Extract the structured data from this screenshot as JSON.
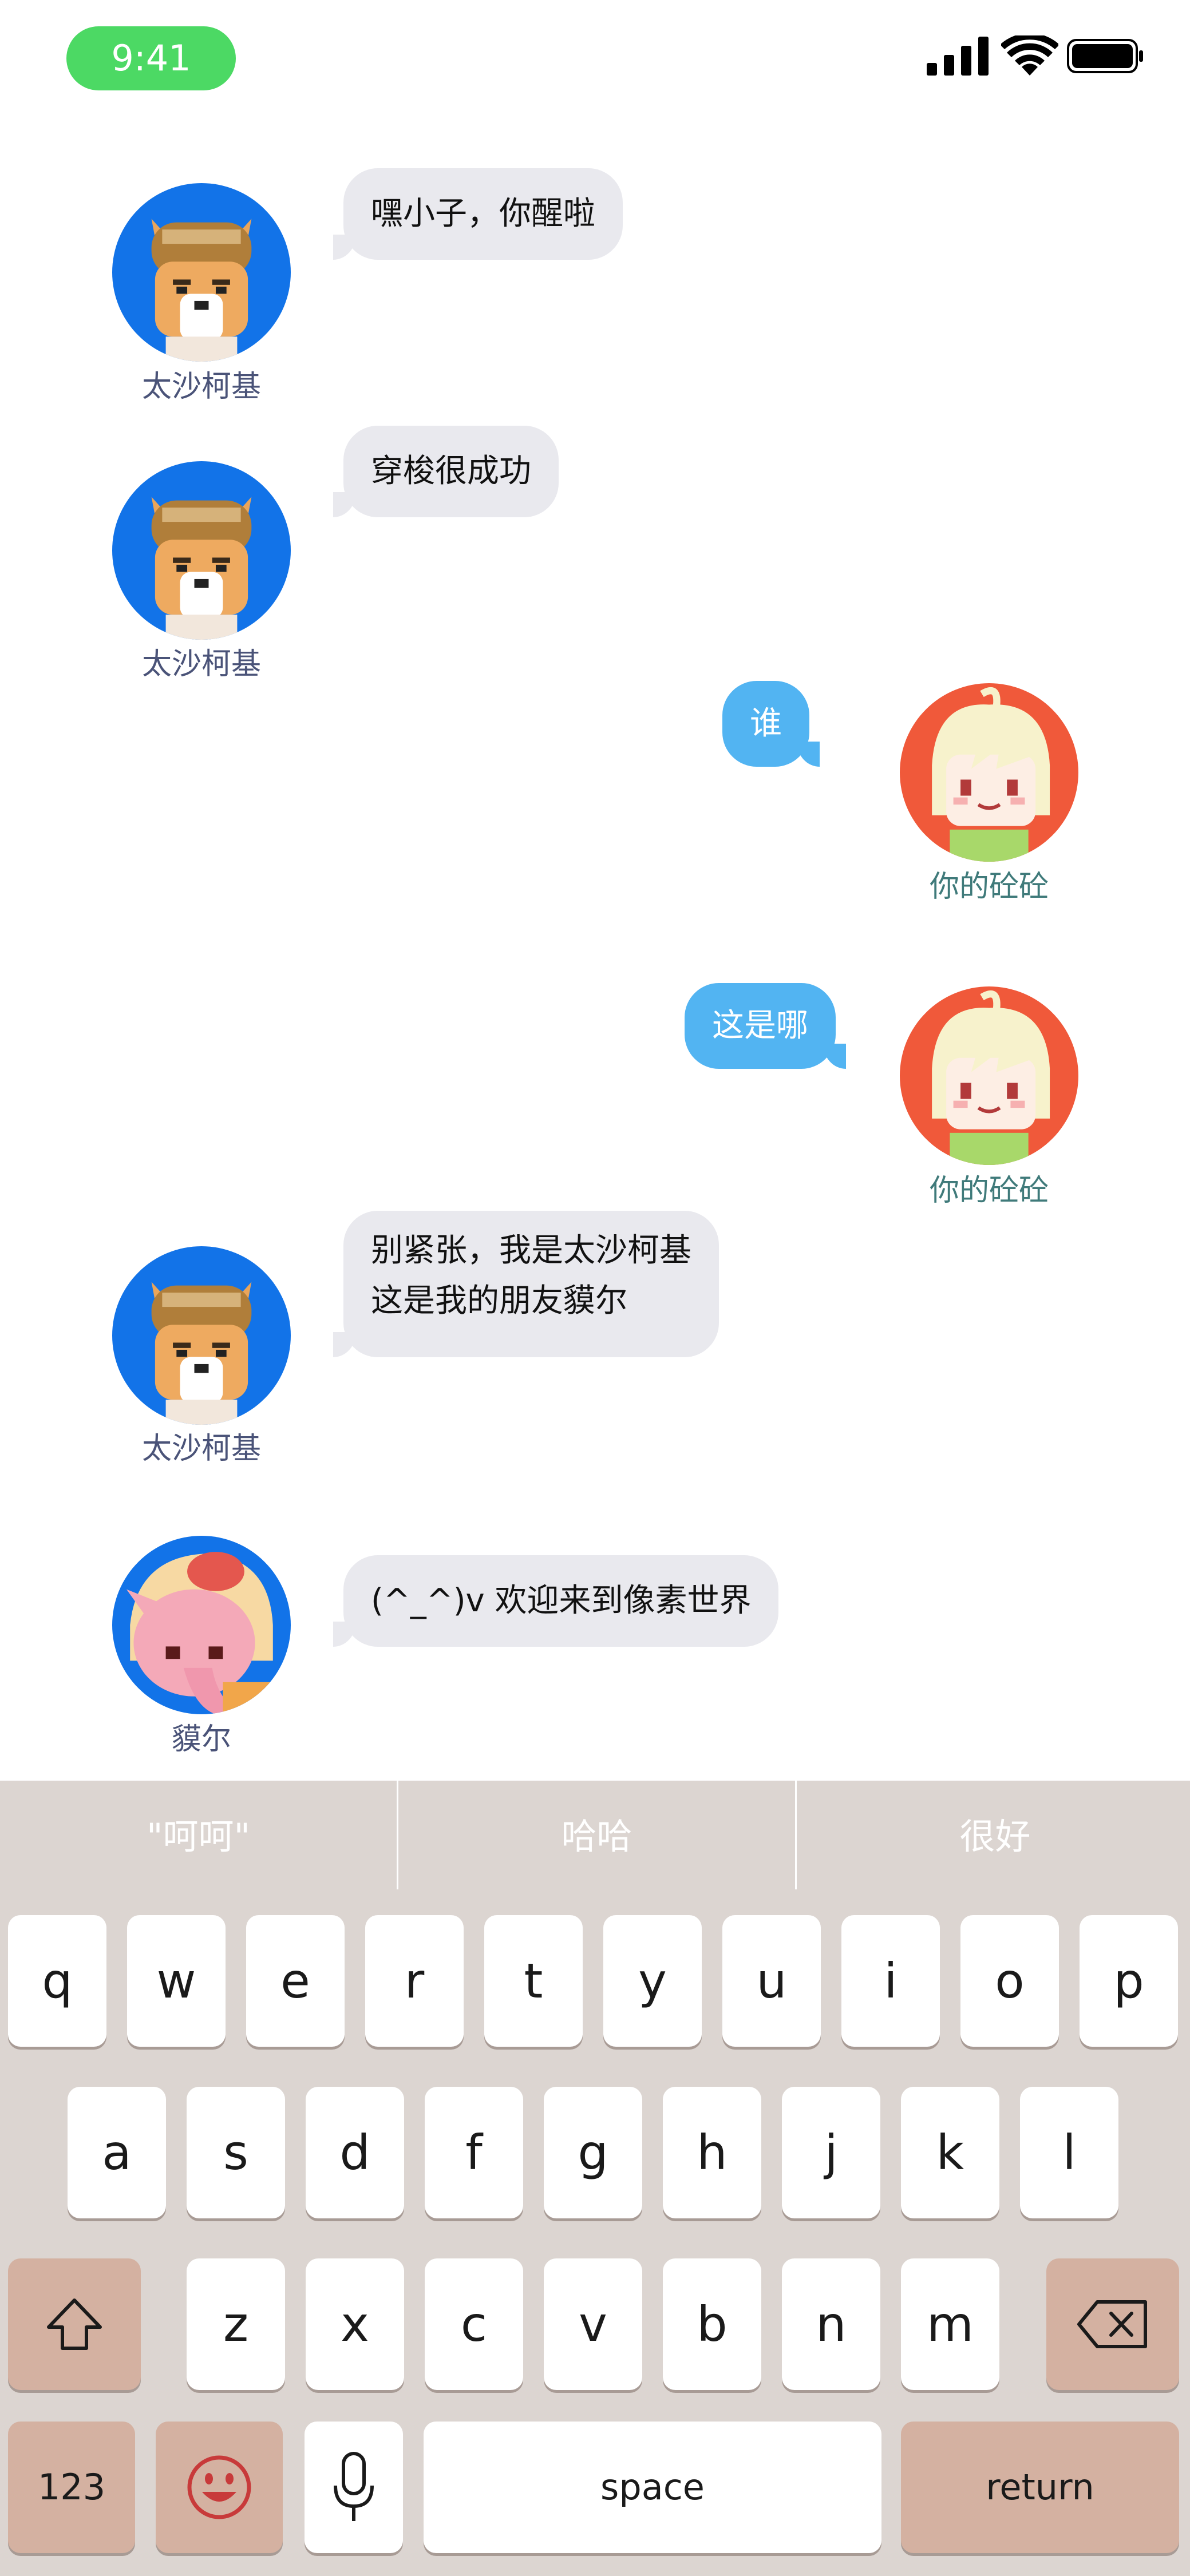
{
  "status_bar": {
    "time": "9:41"
  },
  "messages": [
    {
      "side": "left",
      "sender": "太沙柯基",
      "lines": [
        "嘿小子，你醒啦"
      ]
    },
    {
      "side": "left",
      "sender": "太沙柯基",
      "lines": [
        "穿梭很成功"
      ]
    },
    {
      "side": "right",
      "sender": "你的砼砼",
      "lines": [
        "谁"
      ]
    },
    {
      "side": "right",
      "sender": "你的砼砼",
      "lines": [
        "这是哪"
      ]
    },
    {
      "side": "left",
      "sender": "太沙柯基",
      "lines": [
        "别紧张，我是太沙柯基",
        "这是我的朋友貘尔"
      ]
    },
    {
      "side": "left",
      "sender": "貘尔",
      "lines": [
        "(^_^)v 欢迎来到像素世界"
      ]
    }
  ],
  "keyboard": {
    "suggestions": [
      "\"呵呵\"",
      "哈哈",
      "很好"
    ],
    "row1": [
      "q",
      "w",
      "e",
      "r",
      "t",
      "y",
      "u",
      "i",
      "o",
      "p"
    ],
    "row2": [
      "a",
      "s",
      "d",
      "f",
      "g",
      "h",
      "j",
      "k",
      "l"
    ],
    "row3": [
      "z",
      "x",
      "c",
      "v",
      "b",
      "n",
      "m"
    ],
    "numbers_label": "123",
    "space_label": "space",
    "return_label": "return"
  },
  "colors": {
    "outgoing_bubble": "#52b4f2",
    "incoming_bubble": "#e9e9ee",
    "corgi_avatar_bg": "#1273e8",
    "tongtong_avatar_bg": "#f0593a",
    "moer_avatar_bg": "#1273e8",
    "time_pill": "#4cd964",
    "keyboard_bg": "#dcd5d1",
    "special_key": "#d4b1a1"
  },
  "icons": {
    "shift": "shift-icon",
    "delete": "backspace-icon",
    "emoji": "emoji-icon",
    "mic": "microphone-icon"
  }
}
